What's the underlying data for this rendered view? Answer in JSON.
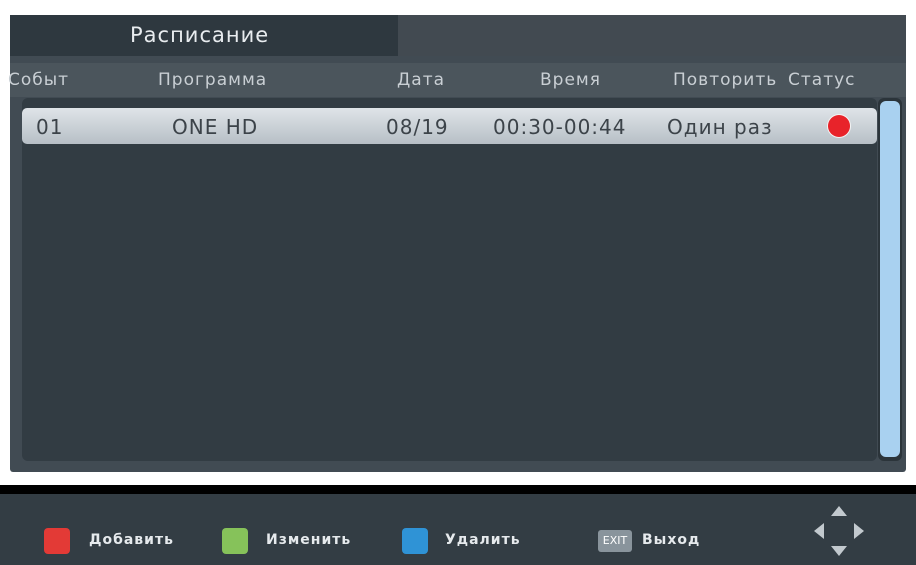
{
  "tab": {
    "title": "Расписание"
  },
  "columns": [
    "Событ",
    "Программа",
    "Дата",
    "Время",
    "Повторить",
    "Статус"
  ],
  "rows": [
    {
      "event": "01",
      "program": "ONE HD",
      "date": "08/19",
      "time": "00:30-00:44",
      "repeat": "Один раз",
      "status_color": "#e8232a"
    }
  ],
  "footer": {
    "add": {
      "label": "Добавить",
      "color": "#e33a36"
    },
    "edit": {
      "label": "Изменить",
      "color": "#86c25a"
    },
    "delete": {
      "label": "Удалить",
      "color": "#2f93d6"
    },
    "exit": {
      "key": "EXIT",
      "label": "Выход"
    }
  },
  "icons": {
    "navigation": "dpad-icon"
  }
}
